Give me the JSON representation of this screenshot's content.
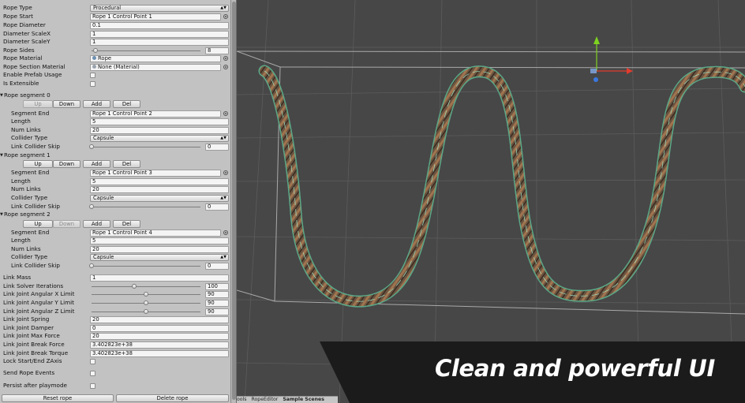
{
  "inspector": {
    "rope_type": {
      "label": "Rope Type",
      "value": "Procedural"
    },
    "rope_start": {
      "label": "Rope Start",
      "value": "Rope 1 Control Point 1"
    },
    "rope_diameter": {
      "label": "Rope Diameter",
      "value": "0.1"
    },
    "diameter_scale_x": {
      "label": "Diameter ScaleX",
      "value": "1"
    },
    "diameter_scale_y": {
      "label": "Diameter ScaleY",
      "value": "1"
    },
    "rope_sides": {
      "label": "Rope Sides",
      "value": "8"
    },
    "rope_material": {
      "label": "Rope Material",
      "value": "Rope"
    },
    "rope_section_material": {
      "label": "Rope Section Material",
      "value": "None (Material)"
    },
    "enable_prefab_usage": {
      "label": "Enable Prefab Usage"
    },
    "is_extensible": {
      "label": "Is Extensible"
    },
    "segment_buttons": {
      "up": "Up",
      "down": "Down",
      "add": "Add",
      "del": "Del"
    },
    "segment_labels": {
      "segment_end": "Segment End",
      "length": "Length",
      "num_links": "Num Links",
      "collider_type": "Collider Type",
      "link_collider_skip": "Link Collider Skip"
    },
    "segments": [
      {
        "title": "Rope segment 0",
        "segment_end": "Rope 1 Control Point 2",
        "length": "5",
        "num_links": "20",
        "collider_type": "Capsule",
        "link_collider_skip": "0"
      },
      {
        "title": "Rope segment 1",
        "segment_end": "Rope 1 Control Point 3",
        "length": "5",
        "num_links": "20",
        "collider_type": "Capsule",
        "link_collider_skip": "0"
      },
      {
        "title": "Rope segment 2",
        "segment_end": "Rope 1 Control Point 4",
        "length": "5",
        "num_links": "20",
        "collider_type": "Capsule",
        "link_collider_skip": "0"
      }
    ],
    "link_mass": {
      "label": "Link Mass",
      "value": "1"
    },
    "link_solver_iterations": {
      "label": "Link Solver Iterations",
      "value": "100"
    },
    "link_joint_angular_x_limit": {
      "label": "Link Joint Angular X Limit",
      "value": "90"
    },
    "link_joint_angular_y_limit": {
      "label": "Link Joint Angular Y Limit",
      "value": "90"
    },
    "link_joint_angular_z_limit": {
      "label": "Link Joint Angular Z Limit",
      "value": "90"
    },
    "link_joint_spring": {
      "label": "Link Joint Spring",
      "value": "20"
    },
    "link_joint_damper": {
      "label": "Link Joint Damper",
      "value": "0"
    },
    "link_joint_max_force": {
      "label": "Link Joint Max Force",
      "value": "20"
    },
    "link_joint_break_force": {
      "label": "Link Joint Break Force",
      "value": "3.402823e+38"
    },
    "link_joint_break_torque": {
      "label": "Link Joint Break Torque",
      "value": "3.402823e+38"
    },
    "lock_start_end_zaxis": {
      "label": "Lock Start/End ZAxis"
    },
    "send_rope_events": {
      "label": "Send Rope Events"
    },
    "persist_after_playmode": {
      "label": "Persist after playmode"
    },
    "reset_rope": "Reset rope",
    "delete_rope": "Delete rope"
  },
  "bottom_bar": {
    "item1": "ools",
    "item2": "RopeEditor",
    "item3": "Sample Scenes"
  },
  "tagline": "Clean and powerful UI",
  "colors": {
    "scene_bg": "#474747",
    "inspector_bg": "#c2c2c2",
    "rope_brown": "#6b5441",
    "rope_wire": "#8fe3c2",
    "gizmo_y": "#7ed321",
    "gizmo_x": "#e23b2e",
    "gizmo_z": "#3a78e0",
    "banner": "#1b1b1b"
  }
}
